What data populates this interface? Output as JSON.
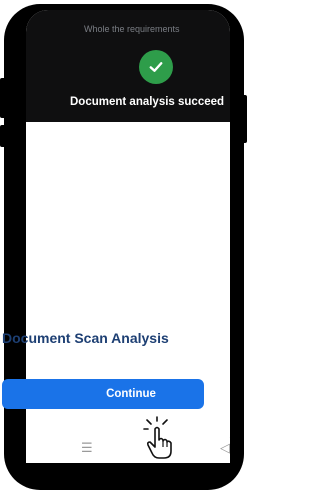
{
  "toast": {
    "background_text": "Whole the requirements",
    "message": "Document analysis succeed",
    "icon": "check-icon",
    "icon_color": "#2e9d4a"
  },
  "main": {
    "title": "Document Scan Analysis",
    "continue_label": "Continue",
    "accent_color": "#1a73e8",
    "title_color": "#1d3f73"
  },
  "nav": {
    "menu_glyph": "☰",
    "home_glyph": "○",
    "back_glyph": "◁"
  }
}
